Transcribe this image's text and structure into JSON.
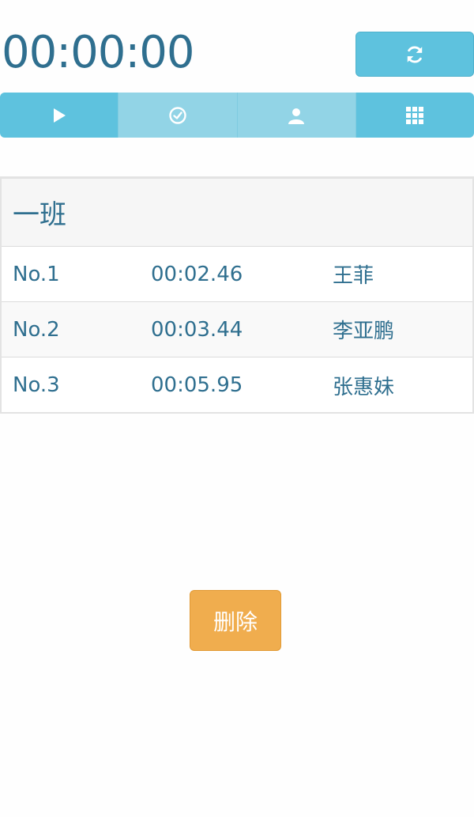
{
  "timer": {
    "display": "00:00:00"
  },
  "header": {
    "reset_icon": "refresh-icon"
  },
  "toolbar": {
    "buttons": [
      {
        "icon": "play-icon",
        "state": "active"
      },
      {
        "icon": "check-circle-icon",
        "state": "inactive"
      },
      {
        "icon": "user-icon",
        "state": "inactive"
      },
      {
        "icon": "grid-icon",
        "state": "active"
      }
    ]
  },
  "panel": {
    "title": "一班",
    "rows": [
      {
        "no": "No.1",
        "time": "00:02.46",
        "name": "王菲"
      },
      {
        "no": "No.2",
        "time": "00:03.44",
        "name": "李亚鹏"
      },
      {
        "no": "No.3",
        "time": "00:05.95",
        "name": "张惠妹"
      }
    ]
  },
  "actions": {
    "delete_label": "删除"
  },
  "colors": {
    "accent": "#5ec2de",
    "accent_light": "#92d4e6",
    "text": "#2f6f8f",
    "warning": "#f0ad4e"
  }
}
